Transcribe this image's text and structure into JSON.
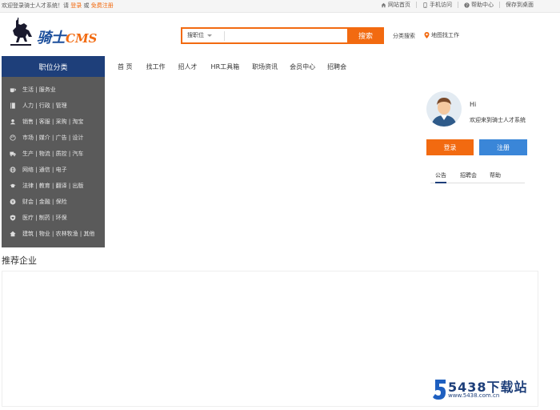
{
  "topbar": {
    "welcome_text": "欢迎登录骑士人才系统！请",
    "login_link": "登录",
    "or_text": "或",
    "register_link": "免费注册",
    "links": [
      {
        "label": "网站首页",
        "icon": "home-icon"
      },
      {
        "label": "手机访问",
        "icon": "mobile-icon"
      },
      {
        "label": "帮助中心",
        "icon": "help-icon"
      },
      {
        "label": "保存到桌面",
        "icon": ""
      }
    ]
  },
  "logo": {
    "text_main": "骑士",
    "text_cms": "CMS"
  },
  "search": {
    "selected_type": "搜职位",
    "placeholder": "",
    "button_label": "搜索",
    "category_search": "分类搜索",
    "map_search": "地图找工作"
  },
  "sidebar": {
    "header": "职位分类",
    "items": [
      {
        "label": "生活 | 服务业",
        "icon": "coffee-icon"
      },
      {
        "label": "人力 | 行政 | 管理",
        "icon": "book-icon"
      },
      {
        "label": "销售 | 客服 | 采购 | 淘宝",
        "icon": "headset-icon"
      },
      {
        "label": "市场 | 媒介 | 广告 | 设计",
        "icon": "palette-icon"
      },
      {
        "label": "生产 | 物流 | 质控 | 汽车",
        "icon": "truck-icon"
      },
      {
        "label": "网络 | 通信 | 电子",
        "icon": "globe-icon"
      },
      {
        "label": "法律 | 教育 | 翻译 | 出版",
        "icon": "graduation-cap-icon"
      },
      {
        "label": "财会 | 金融 | 保险",
        "icon": "yen-coin-icon"
      },
      {
        "label": "医疗 | 制药 | 环保",
        "icon": "shield-heart-icon"
      },
      {
        "label": "建筑 | 物业 | 农林牧渔 | 其他",
        "icon": "home-icon"
      }
    ]
  },
  "mainnav": {
    "items": [
      "首 页",
      "找工作",
      "招人才",
      "HR工具箱",
      "职场资讯",
      "会员中心",
      "招聘会"
    ]
  },
  "user_panel": {
    "hi": "Hi",
    "welcome": "欢迎来到骑士人才系统",
    "login_button": "登录",
    "register_button": "注册",
    "tabs": [
      "公告",
      "招聘会",
      "帮助"
    ],
    "active_tab": "公告"
  },
  "recommend": {
    "title": "推荐企业"
  },
  "watermark": {
    "big": "5438下载站",
    "small": "www.5438.com.cn"
  },
  "colors": {
    "accent": "#f26a10",
    "brand_blue": "#1e3f7a",
    "register_blue": "#3a86d8",
    "sidebar_bg": "#5a5a5a"
  }
}
